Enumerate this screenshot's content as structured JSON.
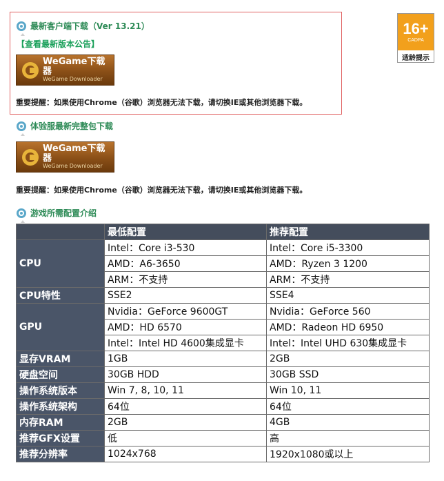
{
  "client_download": {
    "heading": "最新客户端下载（Ver 13.21）",
    "notice_link": "【查看最新版本公告】",
    "button_title": "WeGame下载器",
    "button_subtitle": "WeGame Downloader",
    "warning": "重要提醒：如果使用Chrome（谷歌）浏览器无法下载，请切换IE或其他浏览器下载。"
  },
  "beta_download": {
    "heading": "体验服最新完整包下载",
    "button_title": "WeGame下载器",
    "button_subtitle": "WeGame Downloader",
    "warning": "重要提醒：如果使用Chrome（谷歌）浏览器无法下载，请切换IE或其他浏览器下载。"
  },
  "age_badge": {
    "age": "16+",
    "org": "CADPA",
    "label": "适龄提示"
  },
  "requirements": {
    "heading": "游戏所需配置介绍",
    "columns": [
      "最低配置",
      "推荐配置"
    ],
    "rows": {
      "cpu": {
        "label": "CPU",
        "min": [
          "Intel：Core i3-530",
          "AMD：A6-3650",
          "ARM：不支持"
        ],
        "rec": [
          "Intel：Core i5-3300",
          "AMD：Ryzen 3 1200",
          "ARM：不支持"
        ]
      },
      "cpu_features": {
        "label": "CPU特性",
        "min": "SSE2",
        "rec": "SSE4"
      },
      "gpu": {
        "label": "GPU",
        "min": [
          "Nvidia：GeForce 9600GT",
          "AMD：HD 6570",
          "Intel：Intel HD 4600集成显卡"
        ],
        "rec": [
          "Nvidia：GeForce 560",
          "AMD：Radeon HD 6950",
          "Intel：Intel UHD 630集成显卡"
        ]
      },
      "vram": {
        "label": "显存VRAM",
        "min": "1GB",
        "rec": "2GB"
      },
      "disk": {
        "label": "硬盘空间",
        "min": "30GB HDD",
        "rec": "30GB SSD"
      },
      "os_version": {
        "label": "操作系统版本",
        "min": "Win 7, 8, 10, 11",
        "rec": "Win 10, 11"
      },
      "os_arch": {
        "label": "操作系统架构",
        "min": "64位",
        "rec": "64位"
      },
      "ram": {
        "label": "内存RAM",
        "min": "2GB",
        "rec": "4GB"
      },
      "gfx": {
        "label": "推荐GFX设置",
        "min": "低",
        "rec": "高"
      },
      "resolution": {
        "label": "推荐分辨率",
        "min": "1024x768",
        "rec": "1920x1080或以上"
      }
    }
  }
}
